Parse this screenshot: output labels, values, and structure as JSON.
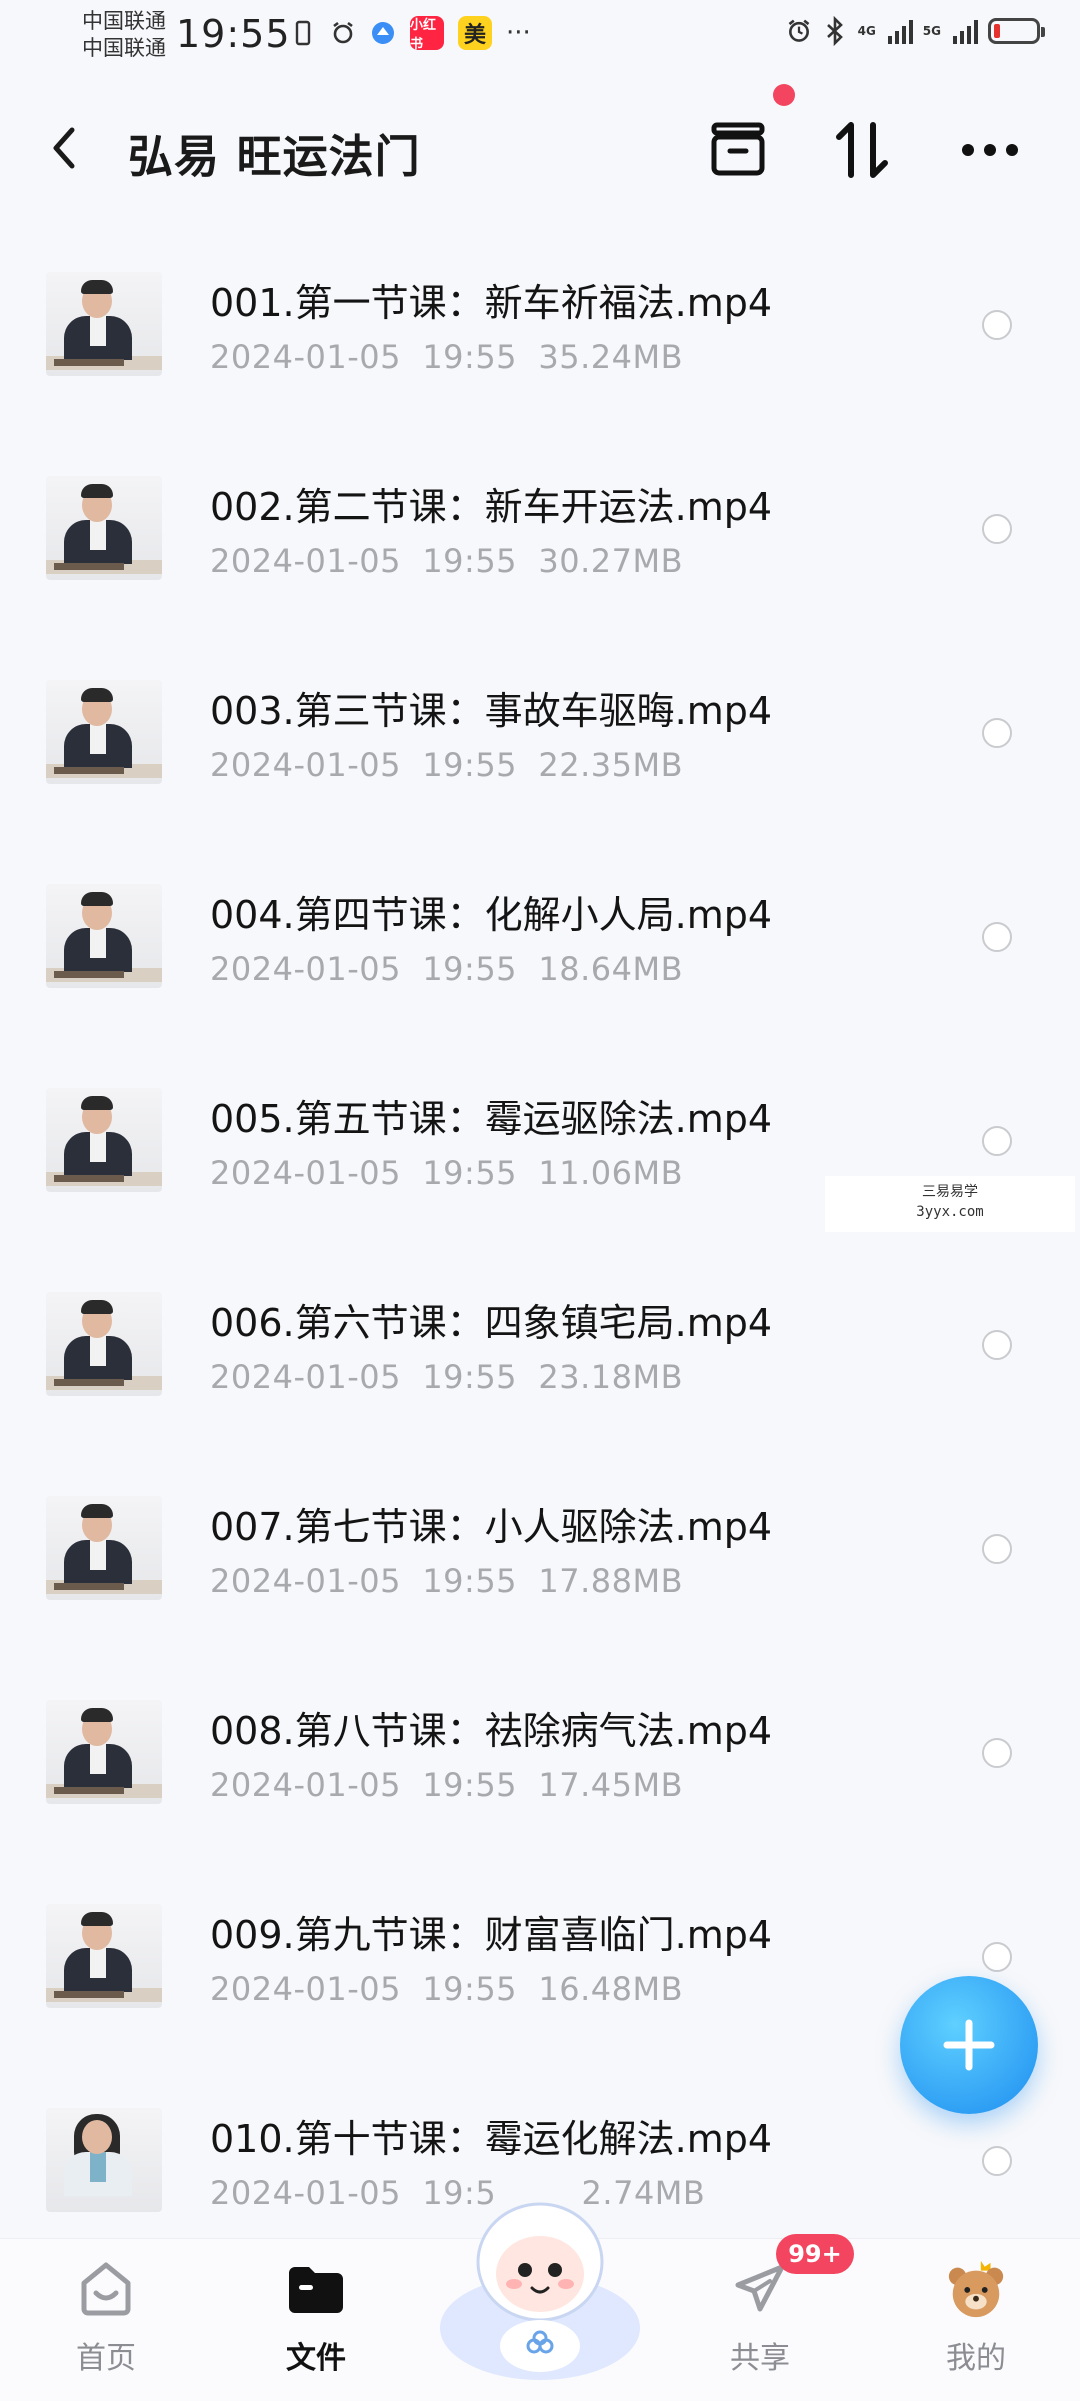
{
  "status_bar": {
    "carrier_1": "中国联通",
    "carrier_2": "中国联通",
    "time": "19:55",
    "app_badge_1": "小红书",
    "app_badge_2": "美",
    "more": "···",
    "net_1": "4G",
    "net_2": "5G"
  },
  "header": {
    "title": "弘易 旺运法门"
  },
  "files": [
    {
      "name": "001.第一节课：新车祈福法.mp4",
      "date": "2024-01-05",
      "time": "19:55",
      "size": "35.24MB"
    },
    {
      "name": "002.第二节课：新车开运法.mp4",
      "date": "2024-01-05",
      "time": "19:55",
      "size": "30.27MB"
    },
    {
      "name": "003.第三节课：事故车驱晦.mp4",
      "date": "2024-01-05",
      "time": "19:55",
      "size": "22.35MB"
    },
    {
      "name": "004.第四节课：化解小人局.mp4",
      "date": "2024-01-05",
      "time": "19:55",
      "size": "18.64MB"
    },
    {
      "name": "005.第五节课：霉运驱除法.mp4",
      "date": "2024-01-05",
      "time": "19:55",
      "size": "11.06MB"
    },
    {
      "name": "006.第六节课：四象镇宅局.mp4",
      "date": "2024-01-05",
      "time": "19:55",
      "size": "23.18MB"
    },
    {
      "name": "007.第七节课：小人驱除法.mp4",
      "date": "2024-01-05",
      "time": "19:55",
      "size": "17.88MB"
    },
    {
      "name": "008.第八节课：祛除病气法.mp4",
      "date": "2024-01-05",
      "time": "19:55",
      "size": "17.45MB"
    },
    {
      "name": "009.第九节课：财富喜临门.mp4",
      "date": "2024-01-05",
      "time": "19:55",
      "size": "16.48MB"
    },
    {
      "name": "010.第十节课：霉运化解法.mp4",
      "date": "2024-01-05",
      "time": "19:5",
      "size": "2.74MB"
    }
  ],
  "watermark": {
    "line1": "三易易学",
    "line2": "3yyx.com"
  },
  "bottom_nav": {
    "home": "首页",
    "files": "文件",
    "share": "共享",
    "mine": "我的",
    "share_badge": "99+"
  },
  "colors": {
    "accent": "#1d8df0",
    "badge": "#f3455f",
    "meta_text": "#a7a9ad"
  }
}
